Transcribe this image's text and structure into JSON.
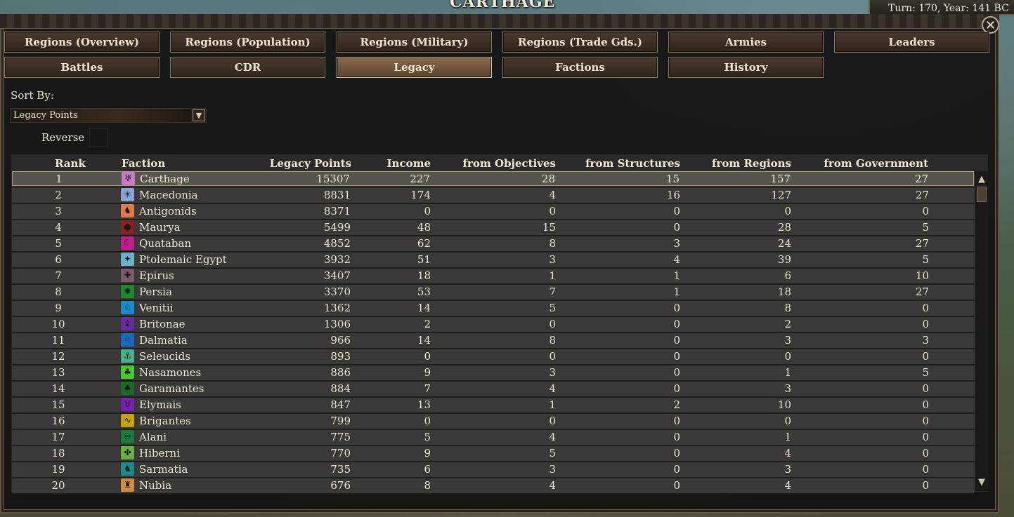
{
  "map": {
    "city_name": "CARTHAGE",
    "turn_label": "Turn: 170, Year: 141 BC"
  },
  "window": {
    "close_label": "✕"
  },
  "tabs": [
    {
      "label": "Regions (Overview)",
      "active": false
    },
    {
      "label": "Regions (Population)",
      "active": false
    },
    {
      "label": "Regions (Military)",
      "active": false
    },
    {
      "label": "Regions (Trade Gds.)",
      "active": false
    },
    {
      "label": "Armies",
      "active": false
    },
    {
      "label": "Leaders",
      "active": false
    },
    {
      "label": "Battles",
      "active": false
    },
    {
      "label": "CDR",
      "active": false
    },
    {
      "label": "Legacy",
      "active": true
    },
    {
      "label": "Factions",
      "active": false
    },
    {
      "label": "History",
      "active": false
    }
  ],
  "sort": {
    "label": "Sort By:",
    "selected": "Legacy Points",
    "reverse_label": "Reverse"
  },
  "table": {
    "columns": [
      "Rank",
      "Faction",
      "Legacy Points",
      "Income",
      "from Objectives",
      "from Structures",
      "from Regions",
      "from Government"
    ],
    "rows": [
      {
        "rank": "1",
        "faction": "Carthage",
        "icon": "carthage-icon",
        "color": "#c979c9",
        "glyph": "♅",
        "lp": "15307",
        "income": "227",
        "obj": "28",
        "str": "15",
        "reg": "157",
        "gov": "27"
      },
      {
        "rank": "2",
        "faction": "Macedonia",
        "icon": "sun-icon",
        "color": "#8aa2d6",
        "glyph": "☀",
        "lp": "8831",
        "income": "174",
        "obj": "4",
        "str": "16",
        "reg": "127",
        "gov": "27"
      },
      {
        "rank": "3",
        "faction": "Antigonids",
        "icon": "beast-icon",
        "color": "#e07a4a",
        "glyph": "♞",
        "lp": "8371",
        "income": "0",
        "obj": "0",
        "str": "0",
        "reg": "0",
        "gov": "0"
      },
      {
        "rank": "4",
        "faction": "Maurya",
        "icon": "elephant-icon",
        "color": "#8a2020",
        "glyph": "●",
        "lp": "5499",
        "income": "48",
        "obj": "15",
        "str": "0",
        "reg": "28",
        "gov": "5"
      },
      {
        "rank": "5",
        "faction": "Quataban",
        "icon": "crescent-icon",
        "color": "#c21c8e",
        "glyph": "☾",
        "lp": "4852",
        "income": "62",
        "obj": "8",
        "str": "3",
        "reg": "24",
        "gov": "27"
      },
      {
        "rank": "6",
        "faction": "Ptolemaic Egypt",
        "icon": "bird-icon",
        "color": "#6ab0c8",
        "glyph": "✦",
        "lp": "3932",
        "income": "51",
        "obj": "3",
        "str": "4",
        "reg": "39",
        "gov": "5"
      },
      {
        "rank": "7",
        "faction": "Epirus",
        "icon": "eagle-icon",
        "color": "#7a5a6a",
        "glyph": "✚",
        "lp": "3407",
        "income": "18",
        "obj": "1",
        "str": "1",
        "reg": "6",
        "gov": "10"
      },
      {
        "rank": "8",
        "faction": "Persia",
        "icon": "griffin-icon",
        "color": "#1a8a2a",
        "glyph": "✺",
        "lp": "3370",
        "income": "53",
        "obj": "7",
        "str": "1",
        "reg": "18",
        "gov": "27"
      },
      {
        "rank": "9",
        "faction": "Venitii",
        "icon": "horse-icon",
        "color": "#1a8ac8",
        "glyph": "♘",
        "lp": "1362",
        "income": "14",
        "obj": "5",
        "str": "0",
        "reg": "8",
        "gov": "0"
      },
      {
        "rank": "10",
        "faction": "Britonae",
        "icon": "dragon-icon",
        "color": "#6a2aa0",
        "glyph": "♝",
        "lp": "1306",
        "income": "2",
        "obj": "0",
        "str": "0",
        "reg": "2",
        "gov": "0"
      },
      {
        "rank": "11",
        "faction": "Dalmatia",
        "icon": "wolf-icon",
        "color": "#1a6ac0",
        "glyph": "♘",
        "lp": "966",
        "income": "14",
        "obj": "8",
        "str": "0",
        "reg": "3",
        "gov": "3"
      },
      {
        "rank": "12",
        "faction": "Seleucids",
        "icon": "anchor-icon",
        "color": "#4ab08a",
        "glyph": "⚓",
        "lp": "893",
        "income": "0",
        "obj": "0",
        "str": "0",
        "reg": "0",
        "gov": "0"
      },
      {
        "rank": "13",
        "faction": "Nasamones",
        "icon": "palm-icon",
        "color": "#4ac830",
        "glyph": "♣",
        "lp": "886",
        "income": "9",
        "obj": "3",
        "str": "0",
        "reg": "1",
        "gov": "5"
      },
      {
        "rank": "14",
        "faction": "Garamantes",
        "icon": "tree-icon",
        "color": "#1a6a2a",
        "glyph": "♣",
        "lp": "884",
        "income": "7",
        "obj": "4",
        "str": "0",
        "reg": "3",
        "gov": "0"
      },
      {
        "rank": "15",
        "faction": "Elymais",
        "icon": "bull-icon",
        "color": "#7a20b0",
        "glyph": "♉",
        "lp": "847",
        "income": "13",
        "obj": "1",
        "str": "2",
        "reg": "10",
        "gov": "0"
      },
      {
        "rank": "16",
        "faction": "Brigantes",
        "icon": "serpent-icon",
        "color": "#c8a010",
        "glyph": "∿",
        "lp": "799",
        "income": "0",
        "obj": "0",
        "str": "0",
        "reg": "0",
        "gov": "0"
      },
      {
        "rank": "17",
        "faction": "Alani",
        "icon": "triskele-icon",
        "color": "#1a7a3a",
        "glyph": "♾",
        "lp": "775",
        "income": "5",
        "obj": "4",
        "str": "0",
        "reg": "1",
        "gov": "0"
      },
      {
        "rank": "18",
        "faction": "Hiberni",
        "icon": "knot-icon",
        "color": "#6ab040",
        "glyph": "✤",
        "lp": "770",
        "income": "9",
        "obj": "5",
        "str": "0",
        "reg": "4",
        "gov": "0"
      },
      {
        "rank": "19",
        "faction": "Sarmatia",
        "icon": "dragonhead-icon",
        "color": "#1a8a8a",
        "glyph": "♞",
        "lp": "735",
        "income": "6",
        "obj": "3",
        "str": "0",
        "reg": "3",
        "gov": "0"
      },
      {
        "rank": "20",
        "faction": "Nubia",
        "icon": "figure-icon",
        "color": "#d08a4a",
        "glyph": "♜",
        "lp": "676",
        "income": "8",
        "obj": "4",
        "str": "0",
        "reg": "4",
        "gov": "0"
      }
    ]
  },
  "scrollbar": {
    "up_glyph": "▲",
    "down_glyph": "▼"
  }
}
